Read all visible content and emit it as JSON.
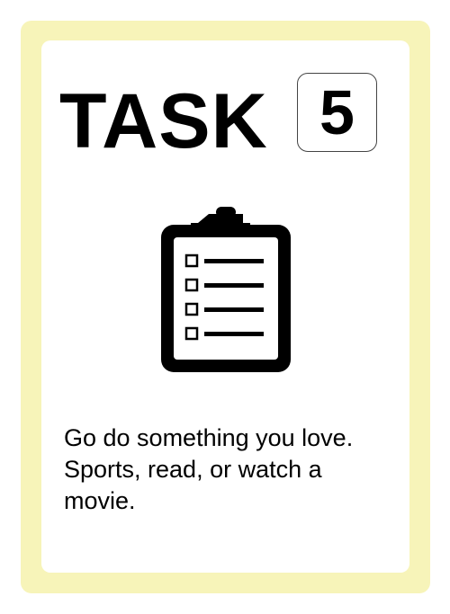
{
  "card": {
    "title": "TASK",
    "number": "5",
    "icon": "clipboard-checklist-icon",
    "description": "Go do something you love. Sports, read, or watch a movie.",
    "colors": {
      "border": "#f7f4b9",
      "background": "#ffffff",
      "text": "#000000"
    }
  }
}
